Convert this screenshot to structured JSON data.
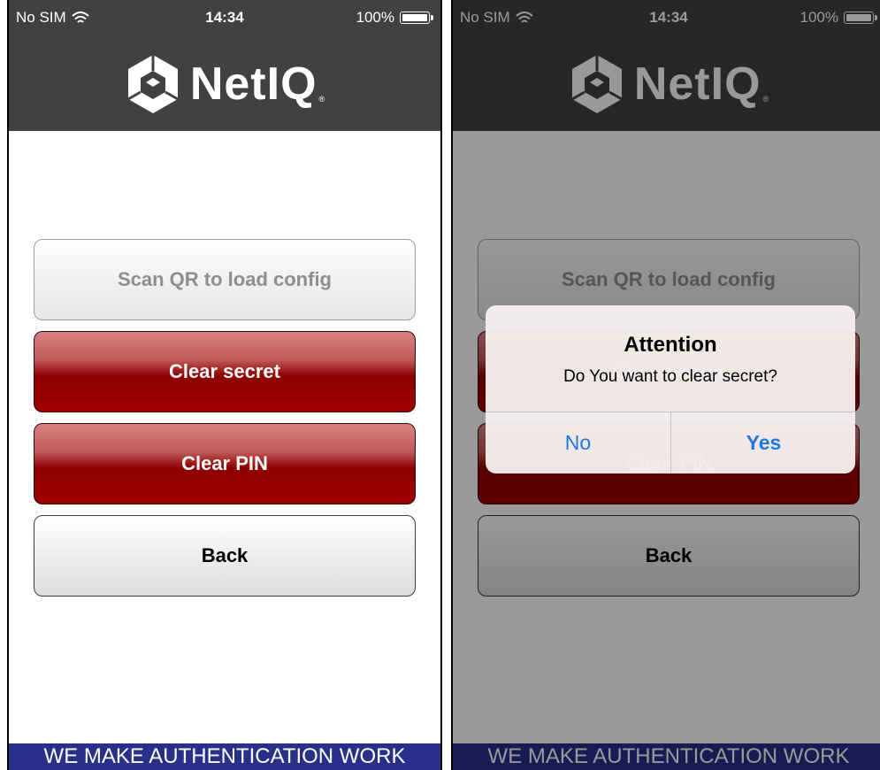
{
  "status_bar": {
    "carrier": "No SIM",
    "time": "14:34",
    "battery": "100%"
  },
  "logo": {
    "text": "NetIQ",
    "registered": "®"
  },
  "buttons": {
    "scan": "Scan QR to load config",
    "clear_secret": "Clear secret",
    "clear_pin": "Clear PIN",
    "back": "Back"
  },
  "footer": {
    "tagline": "WE MAKE AUTHENTICATION WORK"
  },
  "alert": {
    "title": "Attention",
    "message": "Do You want to clear secret?",
    "no_label": "No",
    "yes_label": "Yes"
  },
  "colors": {
    "header": "#414141",
    "footer": "#28308a",
    "clear_button": "#8e0000",
    "alert_button": "#1f7ae0"
  },
  "icons": {
    "wifi": "wifi-icon",
    "battery": "battery-icon",
    "logo": "netiq-cube-logo"
  }
}
